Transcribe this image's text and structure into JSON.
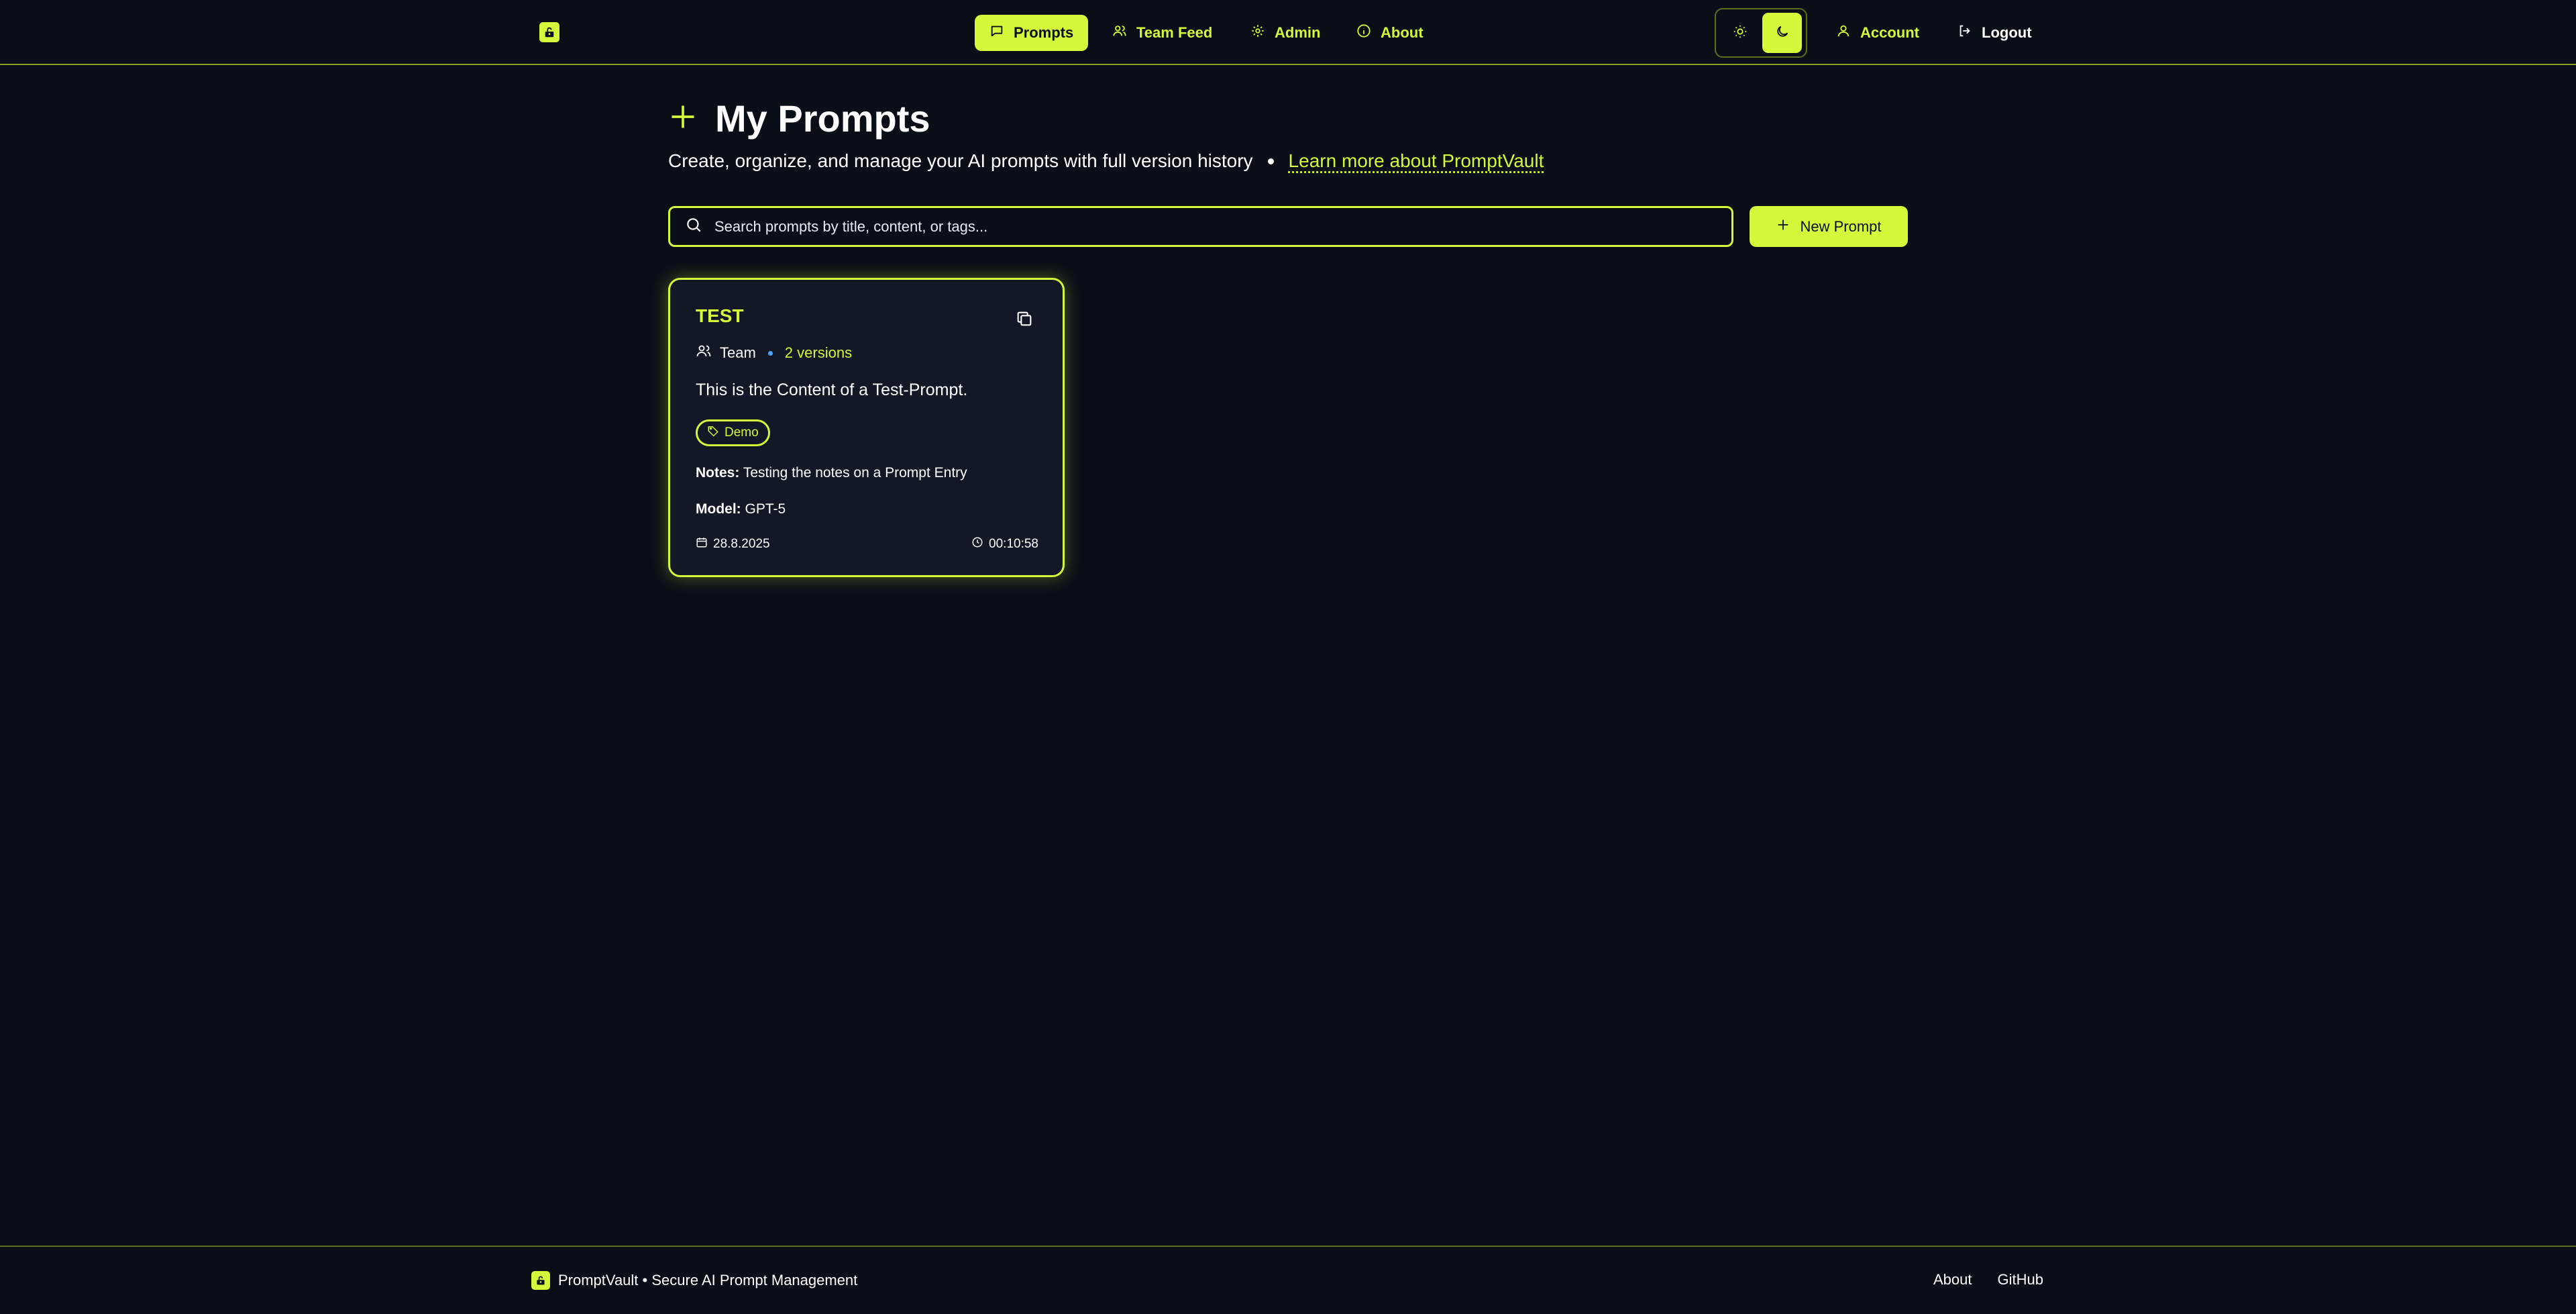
{
  "header": {
    "logo_icon": "key-logo-icon",
    "nav": [
      {
        "label": "Prompts",
        "icon": "message-icon",
        "active": true
      },
      {
        "label": "Team Feed",
        "icon": "users-icon",
        "active": false
      },
      {
        "label": "Admin",
        "icon": "gear-icon",
        "active": false
      },
      {
        "label": "About",
        "icon": "info-icon",
        "active": false
      }
    ],
    "theme": {
      "light_icon": "sun-icon",
      "dark_icon": "moon-icon",
      "selected": "dark"
    },
    "account_label": "Account",
    "logout_label": "Logout"
  },
  "main": {
    "title": "My Prompts",
    "subtitle": "Create, organize, and manage your AI prompts with full version history",
    "learn_more": "Learn more about PromptVault",
    "search_placeholder": "Search prompts by title, content, or tags...",
    "new_prompt_label": "New Prompt"
  },
  "cards": [
    {
      "title": "TEST",
      "visibility": "Team",
      "versions": "2 versions",
      "content": "This is the Content of a Test-Prompt.",
      "tag": "Demo",
      "notes_label": "Notes:",
      "notes": "Testing the notes on a Prompt Entry",
      "model_label": "Model:",
      "model": "GPT-5",
      "date": "28.8.2025",
      "time": "00:10:58"
    }
  ],
  "footer": {
    "brand": "PromptVault • Secure AI Prompt Management",
    "links": [
      "About",
      "GitHub"
    ]
  },
  "colors": {
    "accent": "#d4f83a",
    "background": "#0a0e17",
    "card": "#121826"
  }
}
